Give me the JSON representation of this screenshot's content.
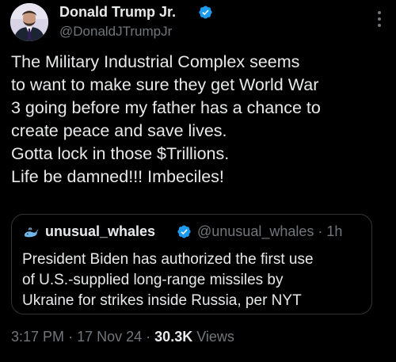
{
  "author": {
    "display_name": "Donald Trump Jr.",
    "handle": "@DonaldJTrumpJr",
    "verified": true
  },
  "tweet": {
    "lines": [
      "The Military Industrial Complex seems",
      "to want to make sure they get World War",
      "3 going before my father has a chance to",
      "create peace and save lives.",
      "Gotta lock in those $Trillions.",
      "Life be damned!!! Imbeciles!"
    ]
  },
  "quote": {
    "display_name": "unusual_whales",
    "handle": "@unusual_whales",
    "time": "1h",
    "separator": "·",
    "verified": true,
    "lines": [
      "President Biden has authorized the first use",
      "of U.S.-supplied long-range missiles by",
      "Ukraine for strikes inside Russia, per NYT"
    ]
  },
  "footer": {
    "time": "3:17 PM",
    "date": "17 Nov 24",
    "views_count": "30.3K",
    "views_label": "Views",
    "separator": "·"
  },
  "icons": {
    "verified": "verified-badge-icon",
    "more": "more-options-icon",
    "quote_avatar": "whale-avatar-icon"
  },
  "colors": {
    "background": "#000000",
    "primary_text": "#e7e9ea",
    "secondary_text": "#71767b",
    "verified_blue": "#1d9bf0",
    "border": "#2f3336"
  }
}
